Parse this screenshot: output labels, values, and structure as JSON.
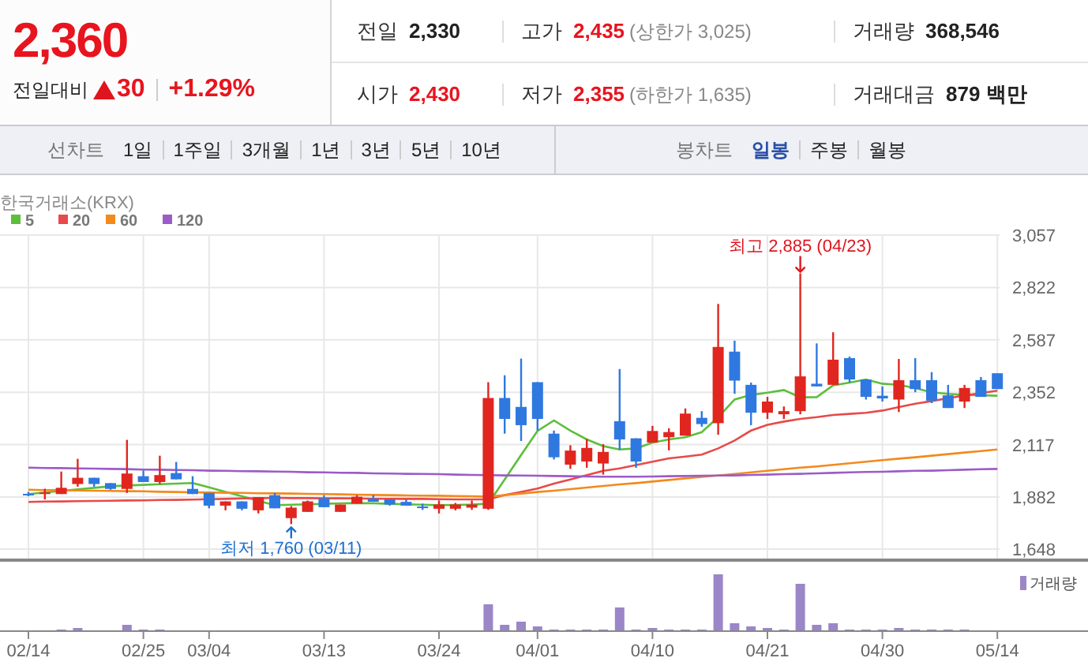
{
  "quote": {
    "price": "2,360",
    "change_label": "전일대비",
    "up": true,
    "change": "30",
    "change_rate": "+1.29%"
  },
  "stats": [
    [
      {
        "label": "전일",
        "value": "2,330",
        "up": false
      },
      {
        "label": "고가",
        "value": "2,435",
        "up": true,
        "note": "(상한가 3,025)"
      },
      {
        "label": "거래량",
        "value": "368,546",
        "up": false
      }
    ],
    [
      {
        "label": "시가",
        "value": "2,430",
        "up": true
      },
      {
        "label": "저가",
        "value": "2,355",
        "up": true,
        "note": "(하한가 1,635)"
      },
      {
        "label": "거래대금",
        "value": "879 백만",
        "up": false
      }
    ]
  ],
  "line_chart_tabs": {
    "label": "선차트",
    "items": [
      {
        "label": "1일",
        "selected": false
      },
      {
        "label": "1주일",
        "selected": false
      },
      {
        "label": "3개월",
        "selected": false
      },
      {
        "label": "1년",
        "selected": false
      },
      {
        "label": "3년",
        "selected": false
      },
      {
        "label": "5년",
        "selected": false
      },
      {
        "label": "10년",
        "selected": false
      }
    ]
  },
  "candle_chart_tabs": {
    "label": "봉차트",
    "items": [
      {
        "label": "일봉",
        "selected": true
      },
      {
        "label": "주봉",
        "selected": false
      },
      {
        "label": "월봉",
        "selected": false
      }
    ]
  },
  "chart": {
    "source": "한국거래소(KRX)",
    "volume_label": "거래량",
    "chart_data": {
      "type": "candlestick",
      "categories": [
        "02/14",
        null,
        null,
        null,
        null,
        null,
        null,
        "02/25",
        null,
        null,
        null,
        "03/04",
        null,
        null,
        null,
        null,
        null,
        null,
        "03/13",
        null,
        null,
        null,
        null,
        null,
        null,
        "03/24",
        null,
        null,
        null,
        null,
        null,
        "04/01",
        null,
        null,
        null,
        null,
        null,
        null,
        "04/10",
        null,
        null,
        null,
        null,
        null,
        null,
        "04/21",
        null,
        null,
        null,
        null,
        null,
        null,
        "04/30",
        null,
        null,
        null,
        null,
        null,
        null,
        "05/14"
      ],
      "ohlc": [
        [
          1896,
          1905,
          1885,
          1894
        ],
        [
          1899,
          1919,
          1871,
          1902
        ],
        [
          1895,
          1996,
          1895,
          1923
        ],
        [
          1940,
          2053,
          1928,
          1968
        ],
        [
          1968,
          1968,
          1928,
          1940
        ],
        [
          1944,
          1944,
          1914,
          1918
        ],
        [
          1918,
          2138,
          1900,
          1987
        ],
        [
          1975,
          2001,
          1949,
          1949
        ],
        [
          1949,
          2067,
          1940,
          1980
        ],
        [
          1989,
          2039,
          1961,
          1961
        ],
        [
          1918,
          1975,
          1895,
          1895
        ],
        [
          1900,
          1900,
          1831,
          1843
        ],
        [
          1843,
          1862,
          1822,
          1862
        ],
        [
          1862,
          1862,
          1822,
          1829
        ],
        [
          1822,
          1881,
          1808,
          1881
        ],
        [
          1890,
          1900,
          1831,
          1831
        ],
        [
          1787,
          1841,
          1760,
          1834
        ],
        [
          1815,
          1866,
          1815,
          1862
        ],
        [
          1876,
          1890,
          1836,
          1836
        ],
        [
          1815,
          1848,
          1815,
          1848
        ],
        [
          1852,
          1890,
          1852,
          1883
        ],
        [
          1874,
          1890,
          1860,
          1860
        ],
        [
          1871,
          1871,
          1843,
          1848
        ],
        [
          1860,
          1871,
          1843,
          1843
        ],
        [
          1839,
          1852,
          1824,
          1838
        ],
        [
          1829,
          1866,
          1808,
          1848
        ],
        [
          1829,
          1855,
          1822,
          1848
        ],
        [
          1834,
          1866,
          1824,
          1848
        ],
        [
          1829,
          2397,
          1824,
          2326
        ],
        [
          2326,
          2428,
          2166,
          2232
        ],
        [
          2286,
          2503,
          2133,
          2204
        ],
        [
          2397,
          2397,
          2180,
          2232
        ],
        [
          2166,
          2180,
          2050,
          2060
        ],
        [
          2027,
          2114,
          2008,
          2090
        ],
        [
          2041,
          2142,
          2013,
          2102
        ],
        [
          2032,
          2119,
          1982,
          2084
        ],
        [
          2222,
          2456,
          2093,
          2140
        ],
        [
          2145,
          2145,
          2013,
          2041
        ],
        [
          2126,
          2201,
          2126,
          2178
        ],
        [
          2150,
          2190,
          2091,
          2173
        ],
        [
          2157,
          2279,
          2157,
          2256
        ],
        [
          2237,
          2267,
          2197,
          2209
        ],
        [
          2213,
          2748,
          2161,
          2555
        ],
        [
          2534,
          2583,
          2345,
          2404
        ],
        [
          2385,
          2395,
          2204,
          2260
        ],
        [
          2260,
          2331,
          2232,
          2310
        ],
        [
          2253,
          2288,
          2232,
          2267
        ],
        [
          2267,
          2885,
          2253,
          2423
        ],
        [
          2390,
          2571,
          2378,
          2378
        ],
        [
          2385,
          2621,
          2385,
          2498
        ],
        [
          2505,
          2512,
          2395,
          2409
        ],
        [
          2409,
          2409,
          2319,
          2331
        ],
        [
          2336,
          2378,
          2310,
          2324
        ],
        [
          2319,
          2501,
          2263,
          2406
        ],
        [
          2406,
          2505,
          2352,
          2366
        ],
        [
          2406,
          2442,
          2303,
          2314
        ],
        [
          2338,
          2385,
          2281,
          2281
        ],
        [
          2310,
          2385,
          2281,
          2371
        ],
        [
          2406,
          2420,
          2331,
          2331
        ],
        [
          2437,
          2437,
          2366,
          2366
        ]
      ],
      "series": [
        {
          "name": "5",
          "type": "line",
          "color": "#5cbf3c",
          "values": [
            1895,
            1902,
            1909,
            1916,
            1923,
            1930,
            1933,
            1936,
            1939,
            1942,
            1945,
            1925,
            1905,
            1885,
            1865,
            1845,
            1847,
            1849,
            1851,
            1853,
            1855,
            1853,
            1851,
            1849,
            1847,
            1845,
            1846,
            1848,
            1852,
            1960,
            2070,
            2178,
            2225,
            2180,
            2140,
            2110,
            2095,
            2100,
            2126,
            2140,
            2150,
            2173,
            2240,
            2319,
            2340,
            2350,
            2362,
            2329,
            2330,
            2383,
            2395,
            2409,
            2390,
            2385,
            2370,
            2352,
            2345,
            2340,
            2338,
            2336
          ]
        },
        {
          "name": "20",
          "type": "line",
          "color": "#e84a4a",
          "values": [
            1860,
            1861,
            1862,
            1863,
            1864,
            1865,
            1866,
            1867,
            1868,
            1869,
            1870,
            1872,
            1873,
            1875,
            1876,
            1878,
            1877,
            1877,
            1876,
            1876,
            1875,
            1874,
            1874,
            1873,
            1873,
            1872,
            1871,
            1871,
            1871,
            1890,
            1905,
            1920,
            1942,
            1960,
            1980,
            1999,
            2010,
            2025,
            2040,
            2055,
            2063,
            2072,
            2100,
            2135,
            2180,
            2205,
            2220,
            2232,
            2240,
            2250,
            2255,
            2260,
            2270,
            2285,
            2300,
            2312,
            2325,
            2337,
            2348,
            2359
          ]
        },
        {
          "name": "60",
          "type": "line",
          "color": "#f28a1c",
          "values": [
            1914,
            1913,
            1912,
            1911,
            1910,
            1909,
            1908,
            1907,
            1905,
            1904,
            1903,
            1902,
            1901,
            1900,
            1899,
            1898,
            1897,
            1896,
            1895,
            1894,
            1892,
            1891,
            1890,
            1889,
            1888,
            1887,
            1886,
            1885,
            1883,
            1890,
            1897,
            1904,
            1910,
            1917,
            1924,
            1931,
            1938,
            1944,
            1951,
            1958,
            1965,
            1972,
            1978,
            1985,
            1992,
            1999,
            2006,
            2013,
            2019,
            2026,
            2033,
            2040,
            2047,
            2054,
            2060,
            2067,
            2074,
            2081,
            2088,
            2095
          ]
        },
        {
          "name": "120",
          "type": "line",
          "color": "#9b5cc8",
          "values": [
            2013,
            2012,
            2011,
            2010,
            2009,
            2008,
            2007,
            2005,
            2004,
            2003,
            2002,
            2000,
            1999,
            1998,
            1997,
            1996,
            1995,
            1993,
            1992,
            1991,
            1990,
            1988,
            1987,
            1986,
            1985,
            1984,
            1982,
            1981,
            1980,
            1979,
            1978,
            1977,
            1976,
            1975,
            1974,
            1973,
            1973,
            1973,
            1974,
            1975,
            1976,
            1977,
            1978,
            1979,
            1981,
            1982,
            1984,
            1986,
            1988,
            1990,
            1992,
            1994,
            1995,
            1997,
            1999,
            2000,
            2002,
            2004,
            2006,
            2008
          ]
        }
      ],
      "ylim": [
        1648,
        3057
      ],
      "grid": true,
      "legend": "top left",
      "yticks": [
        {
          "value": 3057,
          "label": "3,057"
        },
        {
          "value": 2822,
          "label": "2,822"
        },
        {
          "value": 2587,
          "label": "2,587"
        },
        {
          "value": 2352,
          "label": "2,352"
        },
        {
          "value": 2117,
          "label": "2,117"
        },
        {
          "value": 1882,
          "label": "1,882"
        },
        {
          "value": 1648,
          "label": "1,648"
        }
      ],
      "annotations": [
        "최고 2,885 (04/23)",
        "최저 1,760 (03/11)"
      ]
    }
  }
}
